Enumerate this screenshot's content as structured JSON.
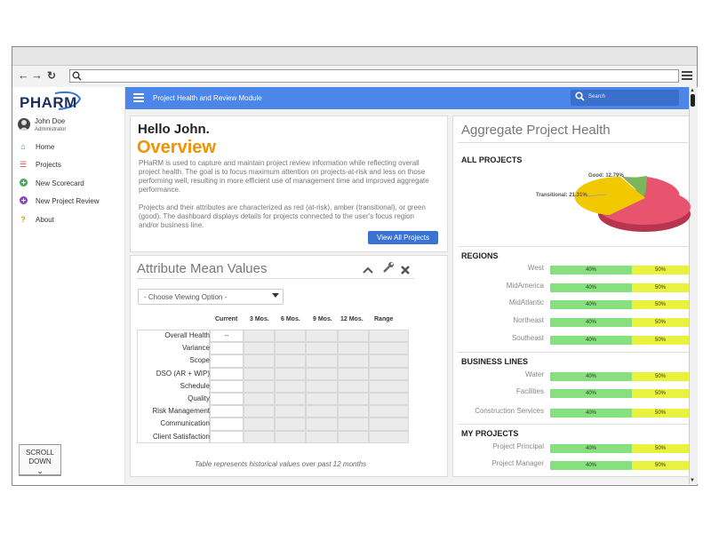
{
  "app": {
    "logo": "PHARM",
    "header_title": "Project Health and Review Module",
    "search_placeholder": "Search"
  },
  "user": {
    "name": "John Doe",
    "role": "Administrator"
  },
  "sidebar": {
    "items": [
      {
        "label": "Home",
        "icon": "home-icon",
        "color": "#3b77c9"
      },
      {
        "label": "Projects",
        "icon": "list-icon",
        "color": "#d9534f"
      },
      {
        "label": "New Scorecard",
        "icon": "plus-circle-icon",
        "color": "#3cab52"
      },
      {
        "label": "New Project Review",
        "icon": "plus-circle-icon",
        "color": "#8b3fc8"
      },
      {
        "label": "About",
        "icon": "question-icon",
        "color": "#e0a100"
      }
    ],
    "scroll_line1": "SCROLL",
    "scroll_line2": "DOWN"
  },
  "overview": {
    "greeting": "Hello John.",
    "title": "Overview",
    "para1": "PHaRM is used to capture and maintain project review information while reflecting overall project health. The goal is to focus maximum attention on projects-at-risk and less on those performing well, resulting in more efficient use of management time and improved aggregate performance.",
    "para2": "Projects and their attributes are characterized as red (at-risk), amber (transitional), or green (good).  The dashboard displays details for projects connected to the user's focus region and/or business line.",
    "button": "View All Projects"
  },
  "attributes": {
    "title": "Attribute Mean Values",
    "select_value": "- Choose Viewing Option -",
    "columns": [
      "Current",
      "3 Mos.",
      "6 Mos.",
      "9 Mos.",
      "12 Mos.",
      "Range"
    ],
    "rows": [
      {
        "label": "Overall Health",
        "current": "--"
      },
      {
        "label": "Variance",
        "current": ""
      },
      {
        "label": "Scope",
        "current": ""
      },
      {
        "label": "DSO (AR + WIP)",
        "current": ""
      },
      {
        "label": "Schedule",
        "current": ""
      },
      {
        "label": "Quality",
        "current": ""
      },
      {
        "label": "Risk Management",
        "current": ""
      },
      {
        "label": "Communication",
        "current": ""
      },
      {
        "label": "Client Satisfaction",
        "current": ""
      }
    ],
    "note": "Table represents historical values over past 12 months"
  },
  "aggregate": {
    "title": "Aggregate Project Health",
    "all_projects": "ALL PROJECTS",
    "pie_labels": {
      "good": "Good: 12.79%",
      "transitional": "Transitional: 21.31%"
    },
    "sections": [
      {
        "title": "REGIONS",
        "rows": [
          {
            "label": "West",
            "green": "40%",
            "yellow": "50%"
          },
          {
            "label": "MidAmerica",
            "green": "40%",
            "yellow": "50%"
          },
          {
            "label": "MidAtlantic",
            "green": "40%",
            "yellow": "50%"
          },
          {
            "label": "Northeast",
            "green": "40%",
            "yellow": "50%"
          },
          {
            "label": "Southeast",
            "green": "40%",
            "yellow": "50%"
          }
        ]
      },
      {
        "title": "BUSINESS LINES",
        "rows": [
          {
            "label": "Water",
            "green": "40%",
            "yellow": "50%"
          },
          {
            "label": "Facilities",
            "green": "40%",
            "yellow": "50%"
          },
          {
            "label": "Construction Services",
            "green": "40%",
            "yellow": "50%"
          }
        ]
      },
      {
        "title": "MY PROJECTS",
        "rows": [
          {
            "label": "Project Principal",
            "green": "40%",
            "yellow": "50%"
          },
          {
            "label": "Project Manager",
            "green": "40%",
            "yellow": "50%"
          }
        ]
      }
    ]
  },
  "chart_data": {
    "type": "pie",
    "slices": [
      {
        "name": "Good",
        "value": 12.79,
        "color": "#7cb65a"
      },
      {
        "name": "Transitional",
        "value": 21.31,
        "color": "#f2c800"
      },
      {
        "name": "At-risk",
        "value": 65.9,
        "color": "#e8546e"
      }
    ]
  }
}
